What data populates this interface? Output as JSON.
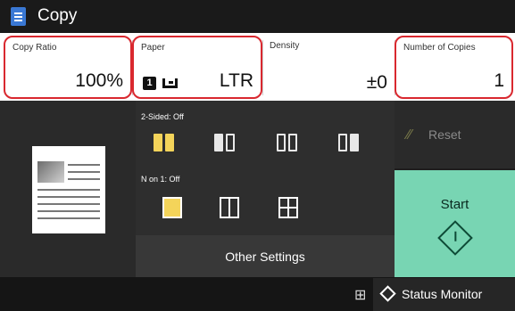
{
  "header": {
    "title": "Copy",
    "icon": "copy-app-icon"
  },
  "settings": {
    "copy_ratio": {
      "label": "Copy Ratio",
      "value": "100%"
    },
    "paper": {
      "label": "Paper",
      "tray_number": "1",
      "size": "LTR",
      "icon": "paper-tray-icon"
    },
    "density": {
      "label": "Density",
      "value": "±0"
    },
    "copies": {
      "label": "Number of Copies",
      "value": "1"
    }
  },
  "options": {
    "two_sided_label": "2-Sided: Off",
    "n_on_1_label": "N on 1: Off",
    "other_settings_label": "Other Settings"
  },
  "actions": {
    "reset_label": "Reset",
    "start_label": "Start"
  },
  "status": {
    "status_monitor_label": "Status Monitor",
    "network_icon": "network-icon"
  },
  "colors": {
    "highlight": "#d9282f",
    "start": "#78d5b3",
    "accent_yellow": "#f4d45a"
  }
}
